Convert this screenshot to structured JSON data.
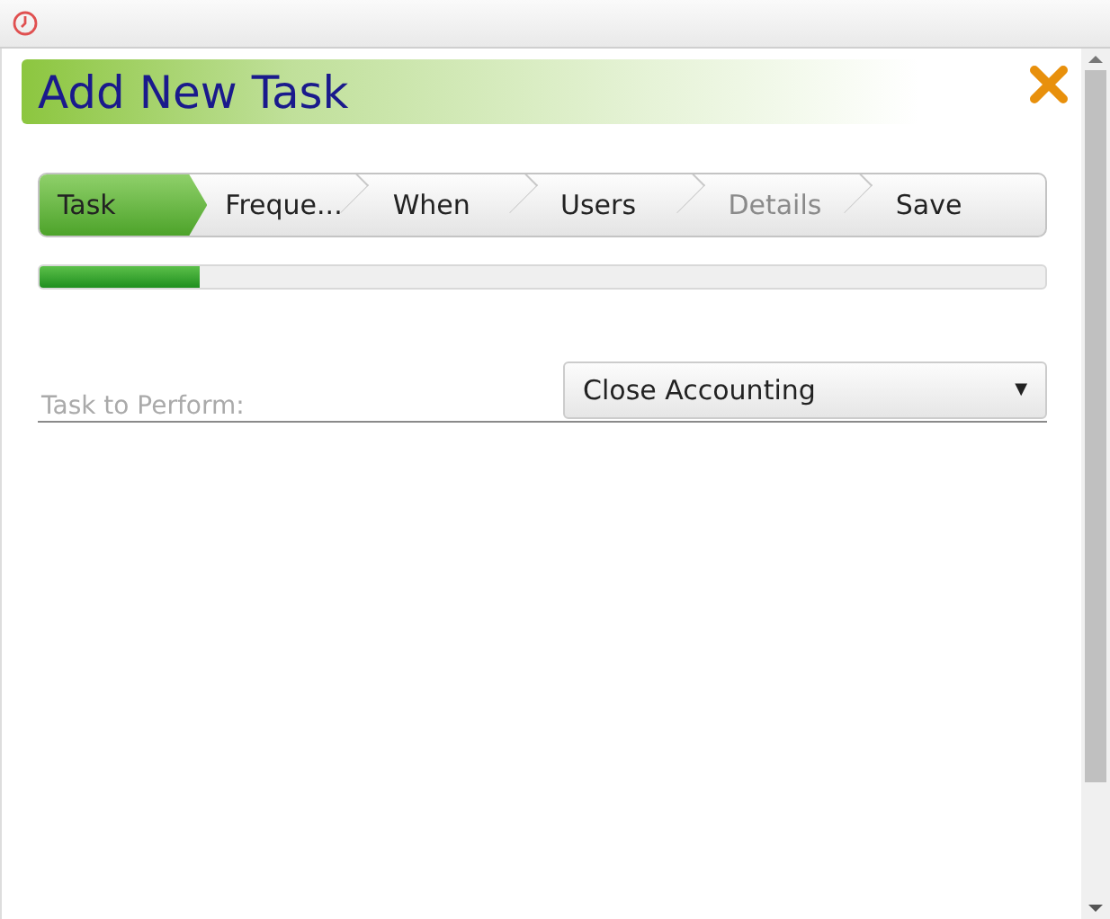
{
  "dialog": {
    "title": "Add New Task"
  },
  "steps": [
    {
      "label": "Task",
      "selected": true,
      "disabled": false
    },
    {
      "label": "Freque...",
      "selected": false,
      "disabled": false
    },
    {
      "label": "When",
      "selected": false,
      "disabled": false
    },
    {
      "label": "Users",
      "selected": false,
      "disabled": false
    },
    {
      "label": "Details",
      "selected": false,
      "disabled": true
    },
    {
      "label": "Save",
      "selected": false,
      "disabled": false
    }
  ],
  "progress": {
    "level": 0.16
  },
  "form": {
    "label": "Task to Perform:",
    "value": "Close Accounting",
    "dropdown_arrow": "▼"
  }
}
